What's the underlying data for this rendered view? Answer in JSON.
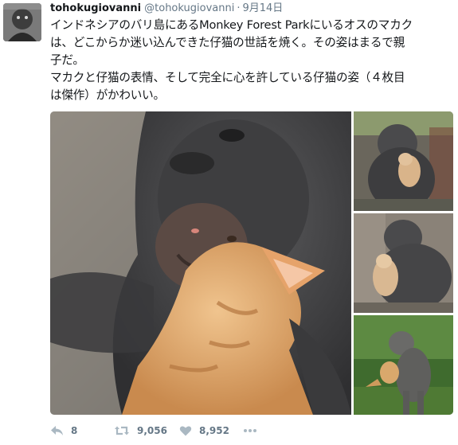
{
  "tweet": {
    "display_name": "tohokugiovanni",
    "handle": "@tohokugiovanni",
    "separator": "·",
    "timestamp": "9月14日",
    "text_lines": [
      "インドネシアのバリ島にあるMonkey Forest Parkにいるオスのマカク",
      "は、どこからか迷い込んできた仔猫の世話を焼く。その姿はまるで親",
      "子だ。",
      "マカクと仔猫の表情、そして完全に心を許している仔猫の姿（４枚目",
      "は傑作）がかわいい。"
    ]
  },
  "actions": {
    "reply_count": "8",
    "retweet_count": "9,056",
    "like_count": "8,952"
  },
  "media": {
    "photo_count": 4
  },
  "colors": {
    "text": "#14171a",
    "muted": "#657786",
    "background": "#ffffff"
  },
  "icons": {
    "reply": "reply-icon",
    "retweet": "retweet-icon",
    "like": "heart-icon",
    "more": "more-dots-icon"
  }
}
